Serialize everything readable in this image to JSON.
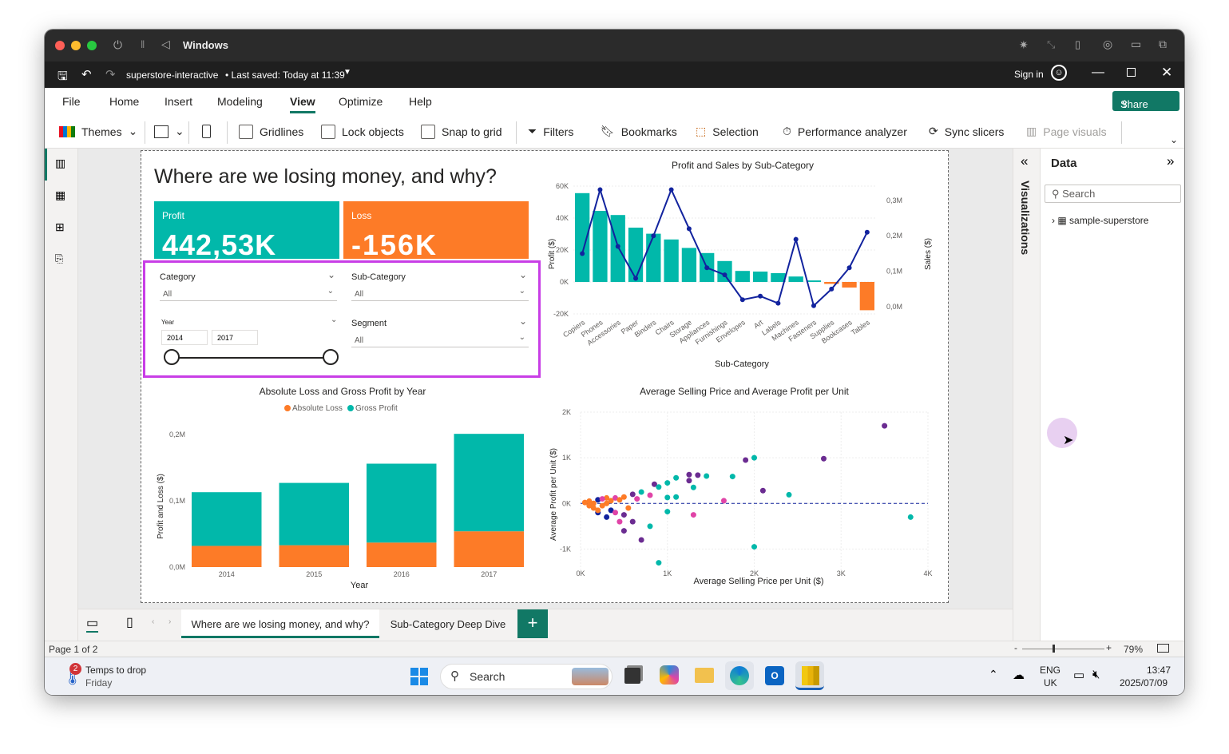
{
  "mac_title": "Windows",
  "pbi": {
    "file": "superstore-interactive",
    "saved": "• Last saved: Today at 11:39",
    "signin": "Sign in"
  },
  "menu": [
    "File",
    "Home",
    "Insert",
    "Modeling",
    "View",
    "Optimize",
    "Help"
  ],
  "share": "Share",
  "ribbon": {
    "themes": "Themes",
    "gridlines": "Gridlines",
    "lock": "Lock objects",
    "snap": "Snap to grid",
    "filters": "Filters",
    "bookmarks": "Bookmarks",
    "selection": "Selection",
    "perf": "Performance analyzer",
    "sync": "Sync slicers",
    "pagevis": "Page visuals"
  },
  "report": {
    "title": "Where are we losing money, and why?",
    "profit_label": "Profit",
    "profit_value": "442,53K",
    "loss_label": "Loss",
    "loss_value": "-156K",
    "slicers": {
      "category": "Category",
      "subcategory": "Sub-Category",
      "year": "Year",
      "segment": "Segment",
      "all": "All",
      "year_from": "2014",
      "year_to": "2017"
    }
  },
  "colors": {
    "teal": "#01b8aa",
    "orange": "#fd7b27",
    "navy": "#12239e",
    "purple": "#6b2c91",
    "highlight": "#c83ee6"
  },
  "chart_data": [
    {
      "type": "bar",
      "title": "Profit and Sales by Sub-Category",
      "xlabel": "Sub-Category",
      "ylabel": "Profit ($)",
      "y2label": "Sales ($)",
      "categories": [
        "Copiers",
        "Phones",
        "Accessories",
        "Paper",
        "Binders",
        "Chairs",
        "Storage",
        "Appliances",
        "Furnishings",
        "Envelopes",
        "Art",
        "Labels",
        "Machines",
        "Fasteners",
        "Supplies",
        "Bookcases",
        "Tables"
      ],
      "ylim": [
        -20000,
        60000
      ],
      "y2lim": [
        -0.02,
        0.34
      ],
      "yticks": [
        "60K",
        "40K",
        "20K",
        "0K",
        "-20K"
      ],
      "y2ticks": [
        "0,3M",
        "0,2M",
        "0,1M",
        "0,0M"
      ],
      "series": [
        {
          "values": [
            55600,
            44500,
            41900,
            34000,
            30200,
            26600,
            21300,
            18100,
            13100,
            6900,
            6500,
            5500,
            3400,
            950,
            -1200,
            -3500,
            -17700
          ]
        },
        {
          "values": [
            0.15,
            0.33,
            0.17,
            0.08,
            0.2,
            0.33,
            0.22,
            0.11,
            0.09,
            0.02,
            0.03,
            0.01,
            0.19,
            0.003,
            0.05,
            0.11,
            0.21
          ]
        }
      ]
    },
    {
      "type": "bar",
      "title": "Absolute Loss and Gross Profit by Year",
      "xlabel": "Year",
      "ylabel": "Profit and Loss ($)",
      "categories": [
        "2014",
        "2015",
        "2016",
        "2017"
      ],
      "ylim": [
        0,
        0.2
      ],
      "yticks": [
        "0,2M",
        "0,1M",
        "0,0M"
      ],
      "series": [
        {
          "name": "Absolute Loss",
          "values": [
            0.032,
            0.033,
            0.037,
            0.054
          ]
        },
        {
          "name": "Gross Profit",
          "values": [
            0.081,
            0.094,
            0.119,
            0.147
          ]
        }
      ]
    },
    {
      "type": "scatter",
      "title": "Average Selling Price and Average Profit per Unit",
      "xlabel": "Average Selling Price per Unit ($)",
      "ylabel": "Average Profit per Unit ($)",
      "xlim": [
        0,
        4000
      ],
      "ylim": [
        -1500,
        2000
      ],
      "xticks": [
        "0K",
        "1K",
        "2K",
        "3K",
        "4K"
      ],
      "yticks": [
        "2K",
        "1K",
        "0K",
        "-1K"
      ],
      "points": [
        [
          3500,
          1700,
          "#6b2c91"
        ],
        [
          2000,
          1000,
          "#01b8aa"
        ],
        [
          1900,
          950,
          "#6b2c91"
        ],
        [
          2800,
          980,
          "#6b2c91"
        ],
        [
          1750,
          590,
          "#01b8aa"
        ],
        [
          1250,
          630,
          "#6b2c91"
        ],
        [
          1350,
          620,
          "#6b2c91"
        ],
        [
          1450,
          600,
          "#01b8aa"
        ],
        [
          1100,
          560,
          "#01b8aa"
        ],
        [
          1250,
          500,
          "#6b2c91"
        ],
        [
          1000,
          450,
          "#01b8aa"
        ],
        [
          2100,
          280,
          "#6b2c91"
        ],
        [
          2400,
          190,
          "#01b8aa"
        ],
        [
          1300,
          350,
          "#01b8aa"
        ],
        [
          850,
          420,
          "#6b2c91"
        ],
        [
          900,
          360,
          "#01b8aa"
        ],
        [
          1100,
          140,
          "#01b8aa"
        ],
        [
          1000,
          130,
          "#01b8aa"
        ],
        [
          800,
          180,
          "#e044a7"
        ],
        [
          1650,
          60,
          "#e044a7"
        ],
        [
          1300,
          -250,
          "#e044a7"
        ],
        [
          1000,
          -180,
          "#01b8aa"
        ],
        [
          500,
          -250,
          "#6b2c91"
        ],
        [
          600,
          -400,
          "#6b2c91"
        ],
        [
          800,
          -500,
          "#01b8aa"
        ],
        [
          500,
          -600,
          "#6b2c91"
        ],
        [
          3800,
          -300,
          "#01b8aa"
        ],
        [
          2000,
          -950,
          "#01b8aa"
        ],
        [
          900,
          -1300,
          "#01b8aa"
        ],
        [
          700,
          -800,
          "#6b2c91"
        ],
        [
          450,
          -400,
          "#e044a7"
        ],
        [
          300,
          -300,
          "#12239e"
        ],
        [
          200,
          -200,
          "#12239e"
        ],
        [
          150,
          -100,
          "#fd7b27"
        ],
        [
          250,
          -50,
          "#fd7b27"
        ],
        [
          350,
          60,
          "#fd7b27"
        ],
        [
          100,
          50,
          "#fd7b27"
        ],
        [
          400,
          120,
          "#e044a7"
        ],
        [
          500,
          140,
          "#fd7b27"
        ],
        [
          600,
          200,
          "#6b2c91"
        ],
        [
          700,
          250,
          "#01b8aa"
        ],
        [
          300,
          120,
          "#fd7b27"
        ],
        [
          200,
          80,
          "#12239e"
        ],
        [
          50,
          20,
          "#fd7b27"
        ],
        [
          100,
          -50,
          "#fd7b27"
        ],
        [
          150,
          0,
          "#fd7b27"
        ],
        [
          250,
          100,
          "#e044a7"
        ],
        [
          350,
          -150,
          "#12239e"
        ],
        [
          450,
          80,
          "#fd7b27"
        ],
        [
          550,
          -100,
          "#fd7b27"
        ],
        [
          650,
          100,
          "#e044a7"
        ],
        [
          200,
          -150,
          "#fd7b27"
        ],
        [
          400,
          -200,
          "#e044a7"
        ],
        [
          300,
          0,
          "#fd7b27"
        ]
      ]
    }
  ],
  "right": {
    "viz": "Visualizations",
    "data": "Data",
    "search": "Search",
    "table": "sample-superstore"
  },
  "tabs": [
    "Where are we losing money, and why?",
    "Sub-Category Deep Dive"
  ],
  "status": {
    "page": "Page 1 of 2",
    "zoom": "79%"
  },
  "taskbar": {
    "weather1": "Temps to drop",
    "weather2": "Friday",
    "badge": "2",
    "search": "Search",
    "lang1": "ENG",
    "lang2": "UK",
    "time": "13:47",
    "date": "2025/07/09"
  }
}
